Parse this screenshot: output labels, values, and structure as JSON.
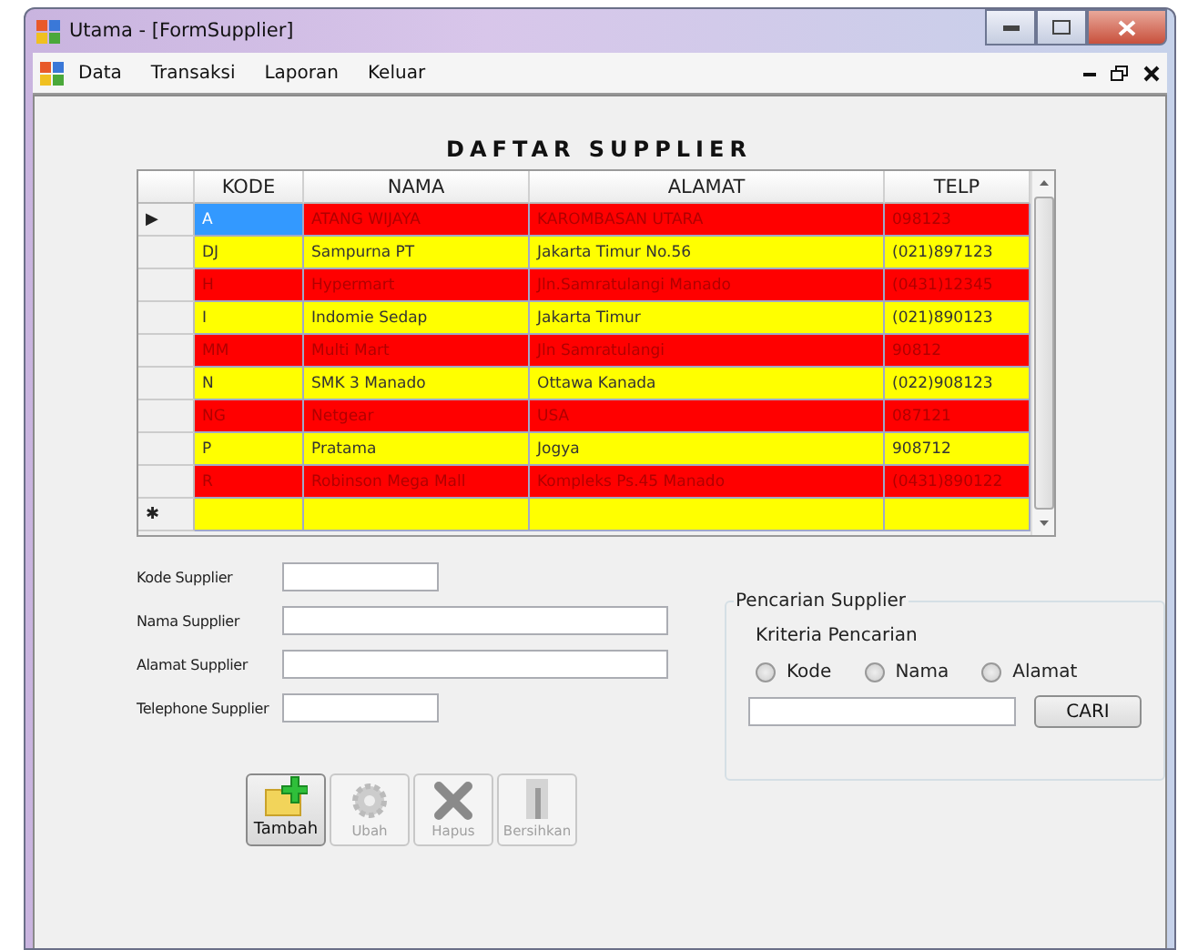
{
  "window": {
    "title": "Utama - [FormSupplier]"
  },
  "menu": [
    "Data",
    "Transaksi",
    "Laporan",
    "Keluar"
  ],
  "heading": "DAFTAR SUPPLIER",
  "table": {
    "columns": [
      "KODE",
      "NAMA",
      "ALAMAT",
      "TELP"
    ],
    "rows": [
      {
        "marker": "▶",
        "color": "#ff0000",
        "cells": [
          "A",
          "ATANG WIJAYA",
          "KAROMBASAN UTARA",
          "098123"
        ],
        "selected": true
      },
      {
        "marker": "",
        "color": "#ffff00",
        "cells": [
          "DJ",
          "Sampurna PT",
          "Jakarta Timur No.56",
          "(021)897123"
        ],
        "selected": false
      },
      {
        "marker": "",
        "color": "#ff0000",
        "cells": [
          "H",
          "Hypermart",
          "Jln.Samratulangi Manado",
          "(0431)12345"
        ],
        "selected": false
      },
      {
        "marker": "",
        "color": "#ffff00",
        "cells": [
          "I",
          "Indomie Sedap",
          "Jakarta Timur",
          "(021)890123"
        ],
        "selected": false
      },
      {
        "marker": "",
        "color": "#ff0000",
        "cells": [
          "MM",
          "Multi Mart",
          "Jln Samratulangi",
          "90812"
        ],
        "selected": false
      },
      {
        "marker": "",
        "color": "#ffff00",
        "cells": [
          "N",
          "SMK 3 Manado",
          "Ottawa Kanada",
          "(022)908123"
        ],
        "selected": false
      },
      {
        "marker": "",
        "color": "#ff0000",
        "cells": [
          "NG",
          "Netgear",
          "USA",
          "087121"
        ],
        "selected": false
      },
      {
        "marker": "",
        "color": "#ffff00",
        "cells": [
          "P",
          "Pratama",
          "Jogya",
          "908712"
        ],
        "selected": false
      },
      {
        "marker": "",
        "color": "#ff0000",
        "cells": [
          "R",
          "Robinson Mega Mall",
          "Kompleks Ps.45 Manado",
          "(0431)890122"
        ],
        "selected": false
      },
      {
        "marker": "✱",
        "color": "#ffff00",
        "cells": [
          "",
          "",
          "",
          ""
        ],
        "selected": false
      }
    ]
  },
  "fields": [
    {
      "label": "Kode Supplier",
      "kind": "short"
    },
    {
      "label": "Nama Supplier",
      "kind": "long"
    },
    {
      "label": "Alamat Supplier",
      "kind": "long"
    },
    {
      "label": "Telephone Supplier",
      "kind": "short"
    }
  ],
  "buttons": [
    {
      "label": "Tambah",
      "kind": "add",
      "disabled": false
    },
    {
      "label": "Ubah",
      "kind": "edit",
      "disabled": true
    },
    {
      "label": "Hapus",
      "kind": "delete",
      "disabled": true
    },
    {
      "label": "Bersihkan",
      "kind": "clear",
      "disabled": true
    }
  ],
  "search": {
    "title": "Pencarian Supplier",
    "criteria_label": "Kriteria Pencarian",
    "options": [
      {
        "label": "Kode",
        "selected": false
      },
      {
        "label": "Nama",
        "selected": false
      },
      {
        "label": "Alamat",
        "selected": false
      }
    ],
    "button": "CARI"
  }
}
